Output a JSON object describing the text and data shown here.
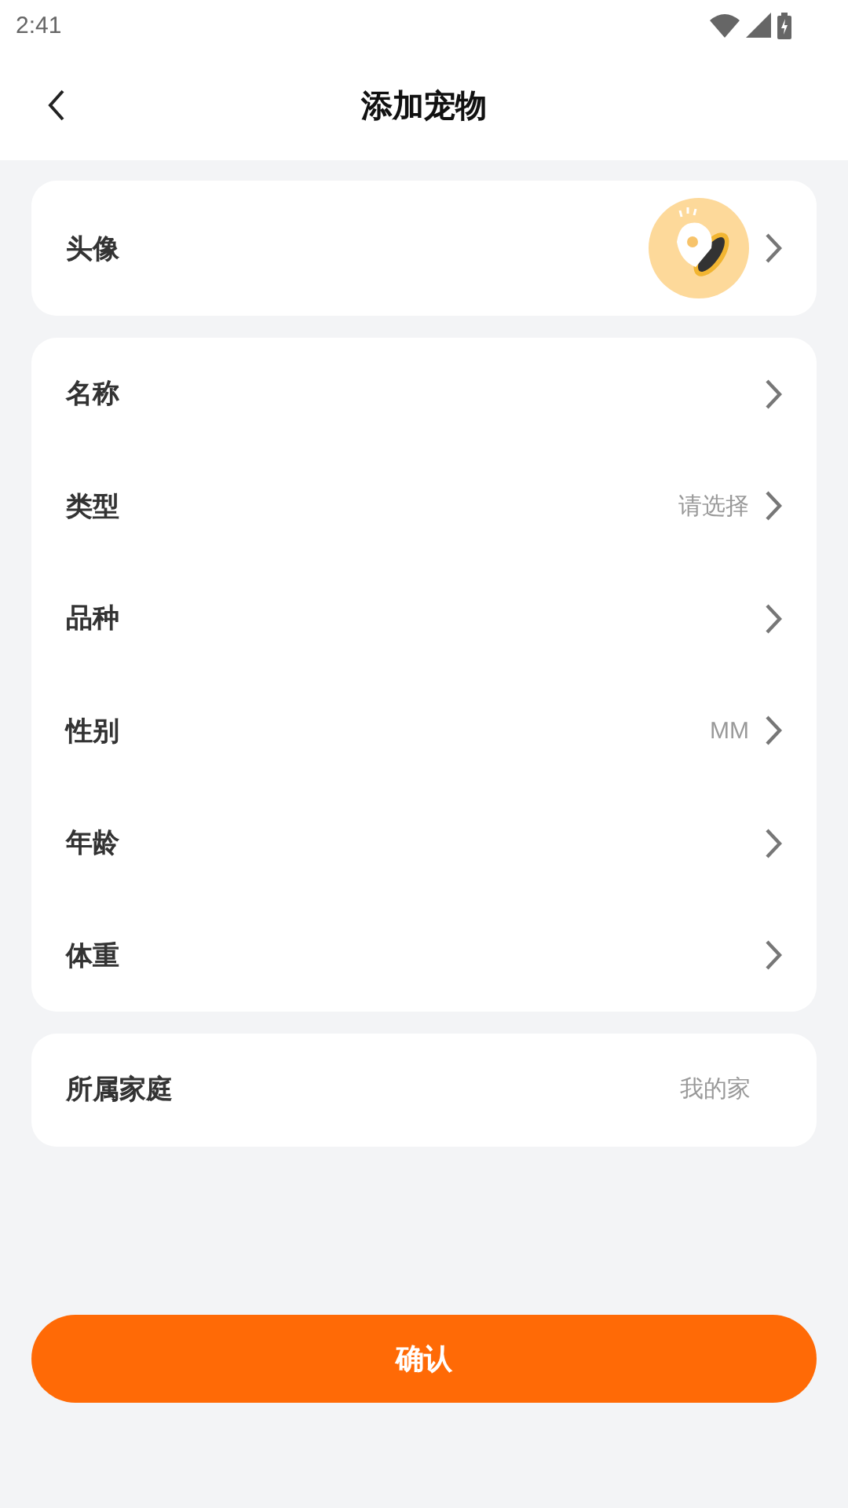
{
  "status_bar": {
    "time": "2:41"
  },
  "header": {
    "title": "添加宠物"
  },
  "sections": [
    {
      "rows": [
        {
          "kind": "avatar",
          "label": "头像"
        }
      ]
    },
    {
      "rows": [
        {
          "kind": "select",
          "label": "名称"
        },
        {
          "kind": "select",
          "label": "类型",
          "value": "请选择"
        },
        {
          "kind": "select",
          "label": "品种"
        },
        {
          "kind": "select",
          "label": "性别",
          "value": "MM"
        },
        {
          "kind": "select",
          "label": "年龄"
        },
        {
          "kind": "select",
          "label": "体重"
        }
      ]
    },
    {
      "rows": [
        {
          "kind": "static",
          "label": "所属家庭",
          "value": "我的家"
        }
      ]
    }
  ],
  "confirm_button": {
    "label": "确认"
  }
}
